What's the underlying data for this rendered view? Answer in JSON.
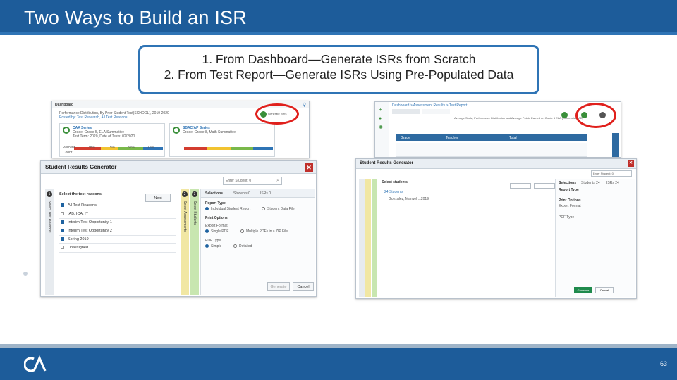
{
  "slide": {
    "title": "Two Ways to Build an ISR",
    "callout_line1": "1. From Dashboard—Generate ISRs from Scratch",
    "callout_line2": "2. From Test Report—Generate ISRs Using Pre-Populated Data",
    "page_number": "63"
  },
  "dashboard_shot": {
    "header": "Dashboard",
    "subtitle": "Performance Distribution, By Prior Student Test(SCHOOL), 2019-2020",
    "card1_title": "CAA Series",
    "card2_title": "SBAC/AP Series",
    "row_labels": [
      "Percent",
      "Count"
    ],
    "values_row": [
      "38%",
      "15%",
      "32%",
      "15%"
    ]
  },
  "report_shot": {
    "breadcrumb": "Dashboard > Assessment Results > Test Report",
    "heading": "Average Scale, Performance Distribution and Average Points Earned on Grade 5 ELA (Summative IAB)",
    "col_headers": [
      "Grade",
      "Teacher",
      "Total"
    ]
  },
  "srg_left": {
    "title": "Student Results Generator",
    "search_placeholder": "Enter Student: 0",
    "step1": {
      "number": "1",
      "vertical_label": "Select Test Reasons",
      "heading": "Select the test reasons.",
      "next_label": "Next",
      "items": [
        {
          "label": "All Test Reasons",
          "checked": true
        },
        {
          "label": "IAB, ICA, IT",
          "checked": false
        },
        {
          "label": "Interim Test Opportunity 1",
          "checked": true
        },
        {
          "label": "Interim Test Opportunity 2",
          "checked": true
        },
        {
          "label": "Spring 2019",
          "checked": true
        },
        {
          "label": "Unassigned",
          "checked": false
        }
      ]
    },
    "step2": {
      "number": "2",
      "vertical_label": "Select Assessments"
    },
    "step3": {
      "number": "3",
      "vertical_label": "Select Students"
    },
    "panel": {
      "tabs": [
        "Selections",
        "Students 0",
        "ISRs 0"
      ],
      "report_type_label": "Report Type",
      "report_options": [
        "Individual Student Report",
        "Student Data File"
      ],
      "print_options_label": "Print Options",
      "export_format_label": "Export Format",
      "export_options": [
        "Single PDF",
        "Multiple PDFs in a ZIP File"
      ],
      "pdf_type_label": "PDF Type",
      "pdf_options": [
        "Simple",
        "Detailed"
      ],
      "generate_label": "Generate",
      "cancel_label": "Cancel"
    }
  },
  "srg_right": {
    "title": "Student Results Generator",
    "search_placeholder": "Enter Student: 0",
    "select_students": "Select students",
    "students_row": "24 Students",
    "student_row2": "Gonzalez, Manuel ...2019",
    "tabs": [
      "Selections",
      "Students 24",
      "ISRs 24"
    ],
    "report_type_label": "Report Type",
    "print_options_label": "Print Options",
    "export_format_label": "Export Format",
    "pdf_type_label": "PDF Type",
    "generate_label": "Generate",
    "cancel_label": "Cancel"
  },
  "colors": {
    "brand_blue": "#1d5c9a",
    "highlight_red": "#e0201c",
    "step_green": "#c8e6b0",
    "step_yellow": "#f1e7a3"
  }
}
